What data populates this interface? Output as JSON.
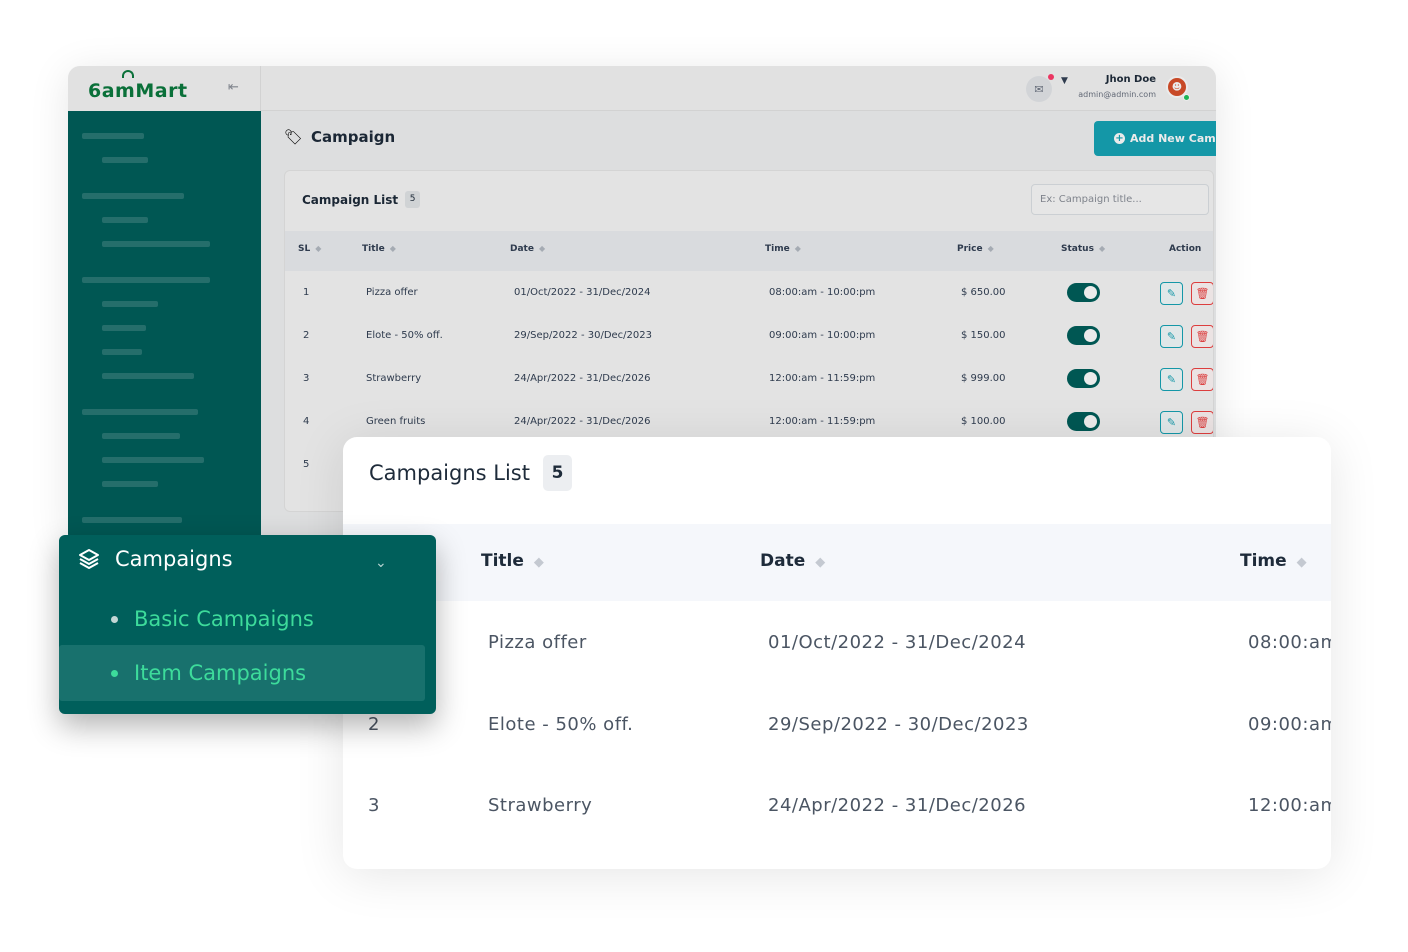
{
  "brand": {
    "logo_text": "6amMart"
  },
  "header": {
    "user_name": "Jhon Doe",
    "user_email": "admin@admin.com"
  },
  "page": {
    "title": "Campaign",
    "add_button_label": "Add New Camp"
  },
  "back_table": {
    "title": "Campaign List",
    "count": "5",
    "search_placeholder": "Ex: Campaign title...",
    "columns": [
      "SL",
      "Title",
      "Date",
      "Time",
      "Price",
      "Status",
      "Action"
    ],
    "rows": [
      {
        "sl": "1",
        "title": "Pizza offer",
        "date": "01/Oct/2022 - 31/Dec/2024",
        "time": "08:00:am - 10:00:pm",
        "price": "$ 650.00"
      },
      {
        "sl": "2",
        "title": "Elote - 50% off.",
        "date": "29/Sep/2022 - 30/Dec/2023",
        "time": "09:00:am - 10:00:pm",
        "price": "$ 150.00"
      },
      {
        "sl": "3",
        "title": "Strawberry",
        "date": "24/Apr/2022 - 31/Dec/2026",
        "time": "12:00:am - 11:59:pm",
        "price": "$ 999.00"
      },
      {
        "sl": "4",
        "title": "Green fruits",
        "date": "24/Apr/2022 - 31/Dec/2026",
        "time": "12:00:am - 11:59:pm",
        "price": "$ 100.00"
      },
      {
        "sl": "5"
      }
    ]
  },
  "front_table": {
    "title": "Campaigns List",
    "count": "5",
    "columns": [
      "Title",
      "Date",
      "Time"
    ],
    "rows": [
      {
        "sl": "",
        "title": "Pizza offer",
        "date": "01/Oct/2022 - 31/Dec/2024",
        "time": "08:00:am"
      },
      {
        "sl": "2",
        "title": "Elote - 50% off.",
        "date": "29/Sep/2022 - 30/Dec/2023",
        "time": "09:00:am"
      },
      {
        "sl": "3",
        "title": "Strawberry",
        "date": "24/Apr/2022 - 31/Dec/2026",
        "time": "12:00:am"
      }
    ]
  },
  "menu": {
    "label": "Campaigns",
    "items": [
      {
        "label": "Basic Campaigns",
        "active": false
      },
      {
        "label": "Item Campaigns",
        "active": true
      }
    ]
  },
  "colors": {
    "sidebar": "#005f5b",
    "accent": "#16a4b6",
    "menu_text": "#3ddb9b",
    "danger": "#ef4444"
  },
  "icons": [
    "collapse-icon",
    "mail-icon",
    "caret-down-icon",
    "avatar",
    "campaign-icon",
    "plus-circle-icon",
    "sort-icon",
    "pencil-icon",
    "trash-icon",
    "layers-icon",
    "chevron-down-icon"
  ]
}
